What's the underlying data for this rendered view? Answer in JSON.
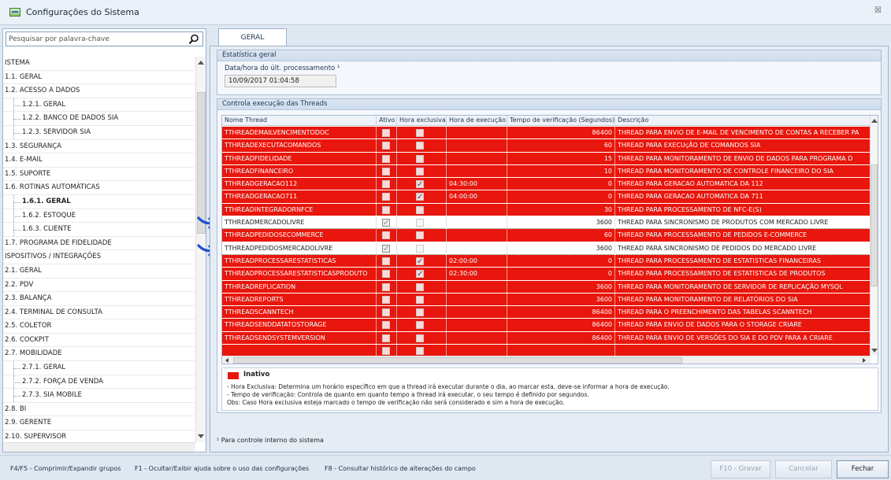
{
  "window": {
    "title": "Configurações do Sistema",
    "close_glyph": "☒"
  },
  "search": {
    "placeholder": "Pesquisar por palavra-chave"
  },
  "tree": [
    {
      "label": "ISTEMA",
      "level": 0
    },
    {
      "label": "1.1. GERAL",
      "level": 0
    },
    {
      "label": "1.2. ACESSO A DADOS",
      "level": 0
    },
    {
      "label": "1.2.1. GERAL",
      "level": 1
    },
    {
      "label": "1.2.2. BANCO DE DADOS SIA",
      "level": 1
    },
    {
      "label": "1.2.3. SERVIDOR SIA",
      "level": 1
    },
    {
      "label": "1.3. SEGURANÇA",
      "level": 0
    },
    {
      "label": "1.4. E-MAIL",
      "level": 0
    },
    {
      "label": "1.5. SUPORTE",
      "level": 0
    },
    {
      "label": "1.6. ROTINAS AUTOMÁTICAS",
      "level": 0
    },
    {
      "label": "1.6.1. GERAL",
      "level": 1,
      "selected": true
    },
    {
      "label": "1.6.2. ESTOQUE",
      "level": 1
    },
    {
      "label": "1.6.3. CLIENTE",
      "level": 1
    },
    {
      "label": "1.7. PROGRAMA DE FIDELIDADE",
      "level": 0
    },
    {
      "label": "ISPOSITIVOS / INTEGRAÇÕES",
      "level": 0
    },
    {
      "label": "2.1. GERAL",
      "level": 0
    },
    {
      "label": "2.2. PDV",
      "level": 0
    },
    {
      "label": "2.3. BALANÇA",
      "level": 0
    },
    {
      "label": "2.4. TERMINAL DE CONSULTA",
      "level": 0
    },
    {
      "label": "2.5. COLETOR",
      "level": 0
    },
    {
      "label": "2.6. COCKPIT",
      "level": 0
    },
    {
      "label": "2.7. MOBILIDADE",
      "level": 0
    },
    {
      "label": "2.7.1. GERAL",
      "level": 1
    },
    {
      "label": "2.7.2. FORÇA DE VENDA",
      "level": 1
    },
    {
      "label": "2.7.3. SIA MOBILE",
      "level": 1
    },
    {
      "label": "2.8. BI",
      "level": 0
    },
    {
      "label": "2.9. GERENTE",
      "level": 0
    },
    {
      "label": "2.10. SUPERVISOR",
      "level": 0
    }
  ],
  "tab": {
    "label": "GERAL"
  },
  "stats": {
    "header": "Estatística geral",
    "field_label": "Data/hora do últ. processamento ¹",
    "field_value": "10/09/2017 01:04:58"
  },
  "threads": {
    "header": "Controla execução das Threads",
    "columns": [
      "Nome Thread",
      "Ativo",
      "Hora exclusiva",
      "Hora de execução",
      "Tempo de verificação (Segundos)",
      "Descrição"
    ],
    "rows": [
      {
        "name": "TTHREADEMAILVENCIMENTODOC",
        "ativo": false,
        "exclusiva": false,
        "hora": "",
        "tempo": "86400",
        "desc": "THREAD PARA ENVIO DE E-MAIL DE VENCIMENTO DE CONTAS A RECEBER PA"
      },
      {
        "name": "TTHREADEXECUTACOMANDOS",
        "ativo": false,
        "exclusiva": false,
        "hora": "",
        "tempo": "60",
        "desc": "THREAD PARA EXECUçÃO DE COMANDOS SIA"
      },
      {
        "name": "TTHREADFIDELIDADE",
        "ativo": false,
        "exclusiva": false,
        "hora": "",
        "tempo": "15",
        "desc": "THREAD PARA MONITORAMENTO DE ENVIO DE DADOS PARA PROGRAMA D"
      },
      {
        "name": "TTHREADFINANCEIRO",
        "ativo": false,
        "exclusiva": false,
        "hora": "",
        "tempo": "10",
        "desc": "THREAD PARA MONITORAMENTO DE CONTROLE FINANCEIRO DO SIA"
      },
      {
        "name": "TTHREADGERACAO112",
        "ativo": false,
        "exclusiva": true,
        "hora": "04:30:00",
        "tempo": "0",
        "desc": "THREAD PARA GERACAO AUTOMATICA DA 112"
      },
      {
        "name": "TTHREADGERACAO711",
        "ativo": false,
        "exclusiva": true,
        "hora": "04:00:00",
        "tempo": "0",
        "desc": "THREAD PARA GERACAO AUTOMATICA DA 711"
      },
      {
        "name": "TTHREADINTEGRADORNFCE",
        "ativo": false,
        "exclusiva": false,
        "hora": "",
        "tempo": "30",
        "desc": "THREAD PARA PROCESSAMENTO DE NFC-E(S)"
      },
      {
        "name": "TTHREADMERCADOLIVRE",
        "ativo": true,
        "exclusiva": false,
        "hora": "",
        "tempo": "3600",
        "desc": "THREAD PARA SINCRONISMO DE PRODUTOS COM MERCADO LIVRE"
      },
      {
        "name": "TTHREADPEDIDOSECOMMERCE",
        "ativo": false,
        "exclusiva": false,
        "hora": "",
        "tempo": "60",
        "desc": "THREAD PARA PROCESSAMENTO DE PEDIDOS E-COMMERCE"
      },
      {
        "name": "TTHREADPEDIDOSMERCADOLIVRE",
        "ativo": true,
        "exclusiva": false,
        "hora": "",
        "tempo": "3600",
        "desc": "THREAD PARA SINCRONISMO DE PEDIDOS DO MERCADO LIVRE"
      },
      {
        "name": "TTHREADPROCESSARESTATISTICAS",
        "ativo": false,
        "exclusiva": true,
        "hora": "02:00:00",
        "tempo": "0",
        "desc": "THREAD PARA PROCESSAMENTO DE ESTATISTICAS FINANCEIRAS"
      },
      {
        "name": "TTHREADPROCESSARESTATISTICASPRODUTO",
        "ativo": false,
        "exclusiva": true,
        "hora": "02:30:00",
        "tempo": "0",
        "desc": "THREAD PARA PROCESSAMENTO DE ESTATISTICAS DE PRODUTOS"
      },
      {
        "name": "TTHREADREPLICATION",
        "ativo": false,
        "exclusiva": false,
        "hora": "",
        "tempo": "3600",
        "desc": "THREAD PARA MONITORAMENTO DE SERVIDOR DE REPLICAÇÃO MYSQL"
      },
      {
        "name": "TTHREADREPORTS",
        "ativo": false,
        "exclusiva": false,
        "hora": "",
        "tempo": "3600",
        "desc": "THREAD PARA MONITORAMENTO DE RELATÓRIOS DO SIA"
      },
      {
        "name": "TTHREADSCANNTECH",
        "ativo": false,
        "exclusiva": false,
        "hora": "",
        "tempo": "86400",
        "desc": "THREAD PARA O PREENCHIMENTO DAS TABELAS SCANNTECH"
      },
      {
        "name": "TTHREADSENDDATATOSTORAGE",
        "ativo": false,
        "exclusiva": false,
        "hora": "",
        "tempo": "86400",
        "desc": "THREAD PARA ENVIO DE DADOS PARA O STORAGE CRIARE"
      },
      {
        "name": "TTHREADSENDSYSTEMVERSION",
        "ativo": false,
        "exclusiva": false,
        "hora": "",
        "tempo": "86400",
        "desc": "THREAD PARA ENVIO DE VERSÕES DO SIA E DO PDV PARA A CRIARE"
      },
      {
        "name": "",
        "ativo": false,
        "exclusiva": false,
        "hora": "",
        "tempo": "",
        "desc": ""
      }
    ]
  },
  "legend": {
    "swatch_color": "#e8160c",
    "title": "Inativo",
    "lines": [
      "- Hora Exclusiva: Determina um horário específico em que a thread irá executar durante o dia, ao marcar esta, deve-se informar a hora de execução.",
      "- Tempo de verificação: Controla de quanto em quanto tempo a thread irá executar, o seu tempo é definido por segundos.",
      "Obs: Caso Hora exclusiva esteja marcado o tempo de verificação não será considerado e sim a hora de execução."
    ]
  },
  "footnote": "¹ Para controle interno do sistema",
  "bottom": {
    "hint1": "F4/F5 - Comprimir/Expandir grupos",
    "hint2": "F1 - Ocultar/Exibir ajuda sobre o uso das configurações",
    "hint3": "F8 - Consultar histórico de alterações do campo",
    "gravar": "F10 - Gravar",
    "cancelar": "Cancelar",
    "fechar": "Fechar"
  },
  "colors": {
    "inactive_row": "#e8160c",
    "arrow": "#1f4fd6"
  },
  "icons": [
    "search-icon",
    "window-icon",
    "close-icon",
    "arrow-annotation-icon"
  ]
}
